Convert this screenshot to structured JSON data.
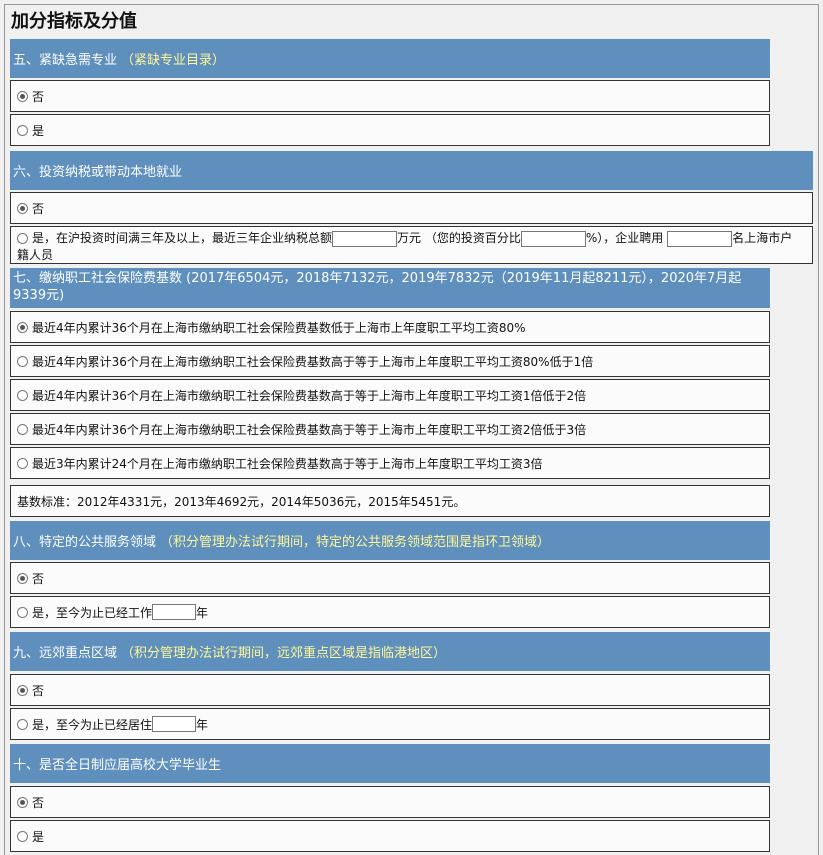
{
  "page_title": "加分指标及分值",
  "s5": {
    "header": "五、紧缺急需专业",
    "note": "（紧缺专业目录）",
    "options": [
      "否",
      "是"
    ]
  },
  "s6": {
    "header": "六、投资纳税或带动本地就业",
    "opt_no": "否",
    "opt_yes_part1": "是，在沪投资时间满三年及以上，最近三年企业纳税总额",
    "opt_yes_part2": "万元 （您的投资百分比",
    "opt_yes_part3": "%），企业聘用",
    "opt_yes_part4": "名上海市户",
    "opt_yes_part5": "籍人员"
  },
  "s7": {
    "header": "七、缴纳职工社会保险费基数 (2017年6504元，2018年7132元，2019年7832元（2019年11月起8211元），2020年7月起9339元)",
    "options": [
      "最近4年内累计36个月在上海市缴纳职工社会保险费基数低于上海市上年度职工平均工资80%",
      "最近4年内累计36个月在上海市缴纳职工社会保险费基数高于等于上海市上年度职工平均工资80%低于1倍",
      "最近4年内累计36个月在上海市缴纳职工社会保险费基数高于等于上海市上年度职工平均工资1倍低于2倍",
      "最近4年内累计36个月在上海市缴纳职工社会保险费基数高于等于上海市上年度职工平均工资2倍低于3倍",
      "最近3年内累计24个月在上海市缴纳职工社会保险费基数高于等于上海市上年度职工平均工资3倍"
    ],
    "base_note": "基数标准：2012年4331元，2013年4692元，2014年5036元，2015年5451元。"
  },
  "s8": {
    "header": "八、特定的公共服务领域",
    "note": "（积分管理办法试行期间，特定的公共服务领域范围是指环卫领域）",
    "opt_no": "否",
    "opt_yes": "是，至今为止已经工作",
    "unit": "年"
  },
  "s9": {
    "header": "九、远郊重点区域",
    "note": "（积分管理办法试行期间，远郊重点区域是指临港地区）",
    "opt_no": "否",
    "opt_yes": "是，至今为止已经居住",
    "unit": "年"
  },
  "s10": {
    "header": "十、是否全日制应届高校大学毕业生",
    "options": [
      "否",
      "是"
    ]
  }
}
